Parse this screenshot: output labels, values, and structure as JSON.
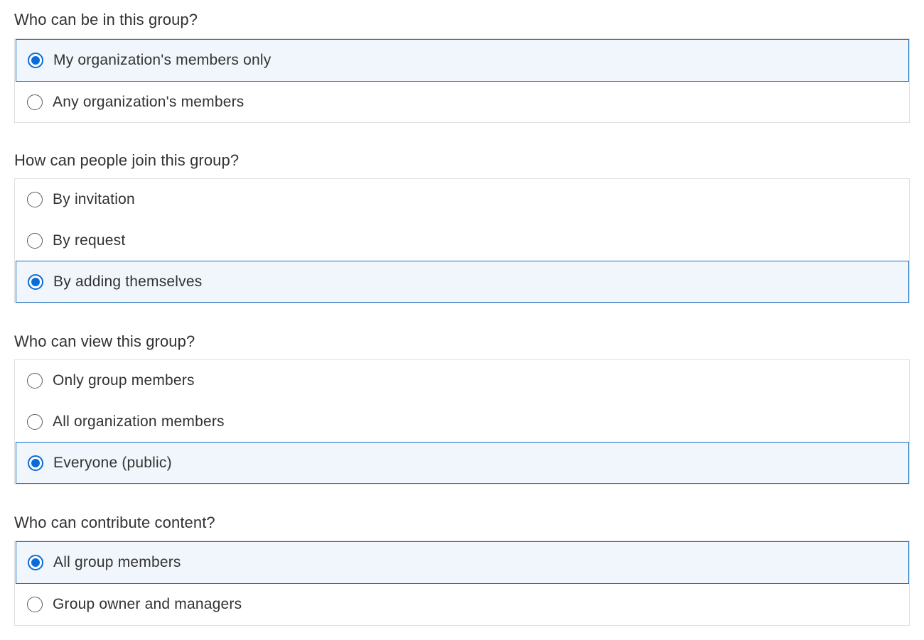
{
  "sections": [
    {
      "heading": "Who can be in this group?",
      "options": [
        {
          "label": "My organization's members only",
          "selected": true
        },
        {
          "label": "Any organization's members",
          "selected": false
        }
      ]
    },
    {
      "heading": "How can people join this group?",
      "options": [
        {
          "label": "By invitation",
          "selected": false
        },
        {
          "label": "By request",
          "selected": false
        },
        {
          "label": "By adding themselves",
          "selected": true
        }
      ]
    },
    {
      "heading": "Who can view this group?",
      "options": [
        {
          "label": "Only group members",
          "selected": false
        },
        {
          "label": "All organization members",
          "selected": false
        },
        {
          "label": "Everyone (public)",
          "selected": true
        }
      ]
    },
    {
      "heading": "Who can contribute content?",
      "options": [
        {
          "label": "All group members",
          "selected": true
        },
        {
          "label": "Group owner and managers",
          "selected": false
        }
      ]
    }
  ],
  "colors": {
    "accent": "#0a6cd8",
    "selected_border": "#1970c2",
    "selected_background": "#f0f6fb",
    "border": "#dfdfdf",
    "text": "#323232"
  }
}
